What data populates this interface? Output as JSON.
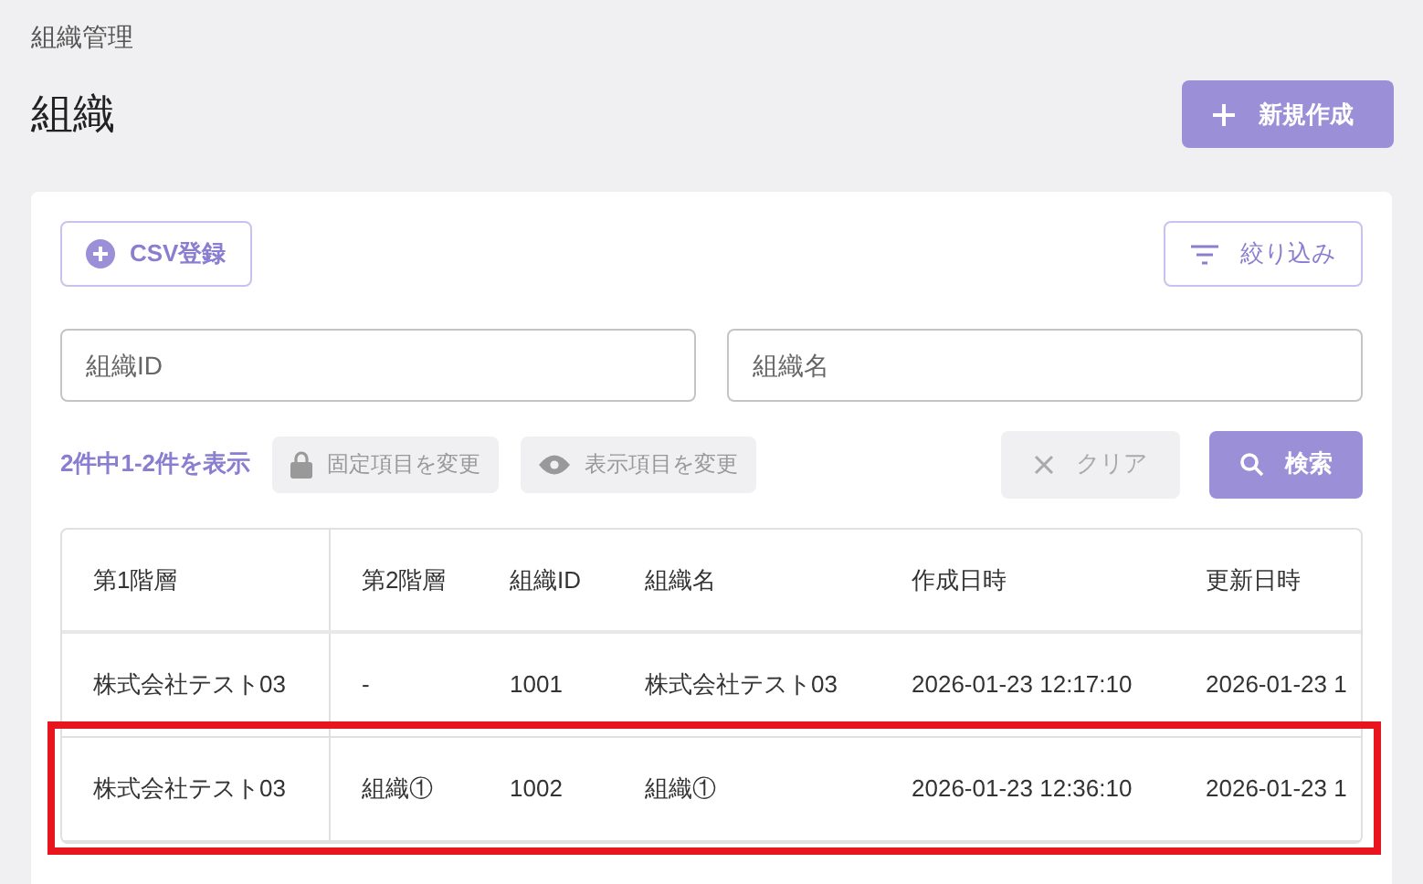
{
  "breadcrumb": "組織管理",
  "title": "組織",
  "new_button": {
    "label": "新規作成"
  },
  "csv_button": {
    "label": "CSV登録"
  },
  "filter_button": {
    "label": "絞り込み"
  },
  "fields": [
    {
      "placeholder": "組織ID"
    },
    {
      "placeholder": "組織名"
    }
  ],
  "result_count": "2件中1-2件を表示",
  "fixed_button": {
    "label": "固定項目を変更"
  },
  "visible_button": {
    "label": "表示項目を変更"
  },
  "clear_button": {
    "label": "クリア"
  },
  "search_button": {
    "label": "検索"
  },
  "table": {
    "columns": [
      "第1階層",
      "第2階層",
      "組織ID",
      "組織名",
      "作成日時",
      "更新日時"
    ],
    "rows": [
      {
        "cells": [
          "株式会社テスト03",
          "-",
          "1001",
          "株式会社テスト03",
          "2026-01-23 12:17:10",
          "2026-01-23 1"
        ],
        "highlighted": false
      },
      {
        "cells": [
          "株式会社テスト03",
          "組織①",
          "1002",
          "組織①",
          "2026-01-23 12:36:10",
          "2026-01-23 1"
        ],
        "highlighted": true
      }
    ]
  }
}
